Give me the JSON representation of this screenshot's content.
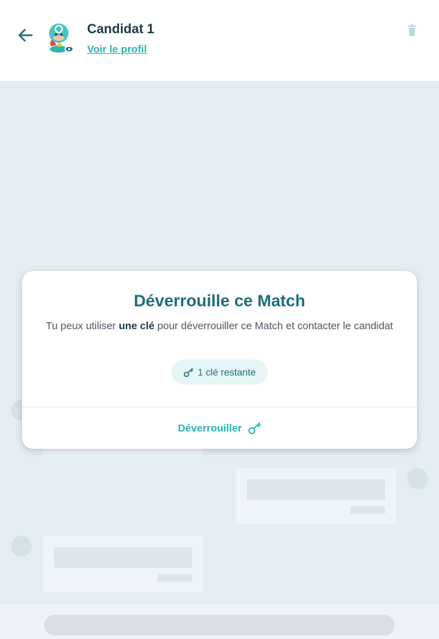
{
  "header": {
    "candidate_name": "Candidat 1",
    "profile_link": "Voir le profil",
    "back_icon": "arrow-left-icon",
    "delete_icon": "trash-icon",
    "avatar_icon": "candidate-avatar"
  },
  "modal": {
    "title": "Déverrouille ce Match",
    "desc_before": "Tu peux utiliser ",
    "desc_bold": "une clé",
    "desc_after": " pour déverrouiller ce Match et contacter le candidat",
    "keys_remaining": "1 clé restante",
    "unlock_label": "Déverrouiller",
    "key_icon": "key-icon"
  },
  "colors": {
    "accent": "#2ab5b0",
    "title": "#1f6f78",
    "background": "#e4eef1"
  }
}
